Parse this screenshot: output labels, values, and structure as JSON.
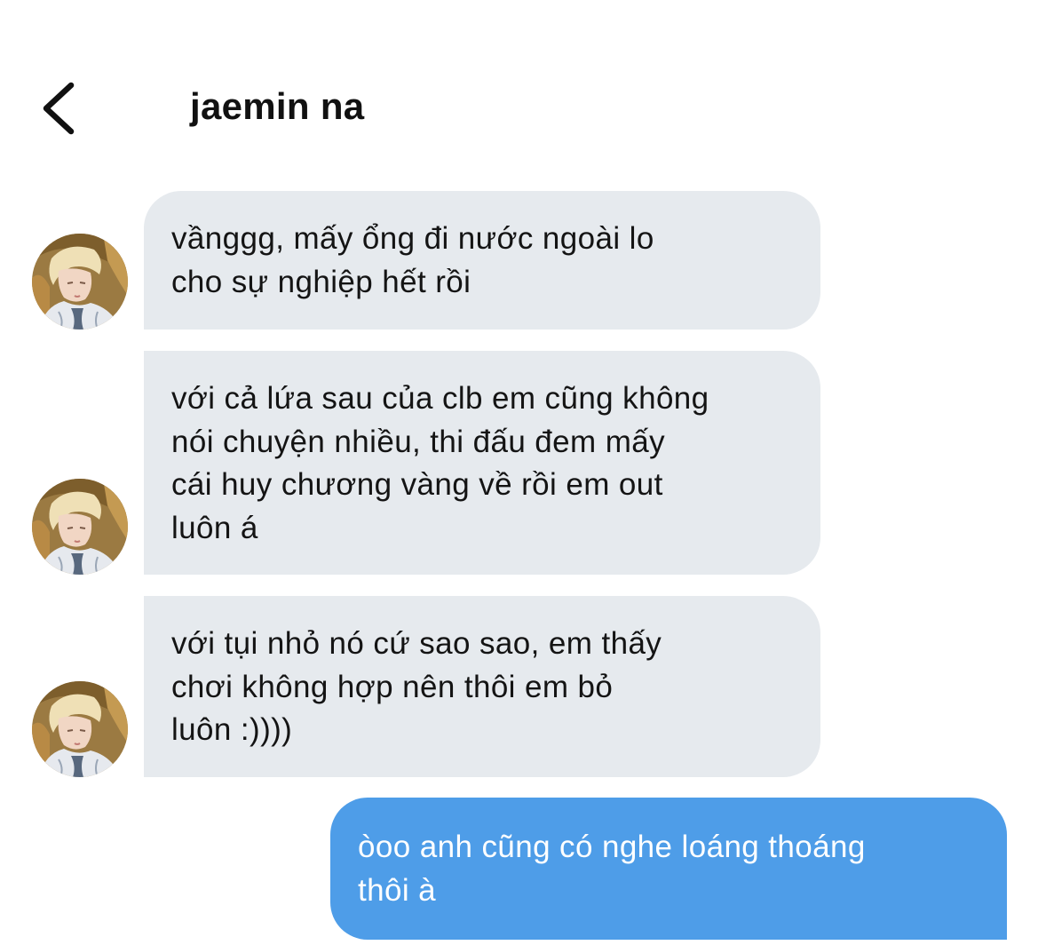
{
  "header": {
    "back_icon": "chevron-left-icon",
    "title": "jaemin na"
  },
  "contact": {
    "avatar_icon": "profile-photo"
  },
  "messages": [
    {
      "sender": "jaemin na",
      "direction": "incoming",
      "text": "vầnggg, mấy ổng đi nước ngoài lo\ncho sự nghiệp hết rồi"
    },
    {
      "sender": "jaemin na",
      "direction": "incoming",
      "text": "với cả lứa sau của clb em cũng không\nnói chuyện nhiều, thi đấu đem mấy\ncái huy chương vàng về rồi em out\nluôn á"
    },
    {
      "sender": "jaemin na",
      "direction": "incoming",
      "text": "với tụi nhỏ nó cứ sao sao, em thấy\nchơi không hợp nên thôi em bỏ\nluôn :))))"
    },
    {
      "sender": "me",
      "direction": "outgoing",
      "text": "òoo anh cũng có nghe loáng thoáng\nthôi à"
    }
  ],
  "colors": {
    "incoming_bubble": "#e6eaee",
    "outgoing_bubble": "#4e9de8",
    "outgoing_text": "#ffffff"
  }
}
